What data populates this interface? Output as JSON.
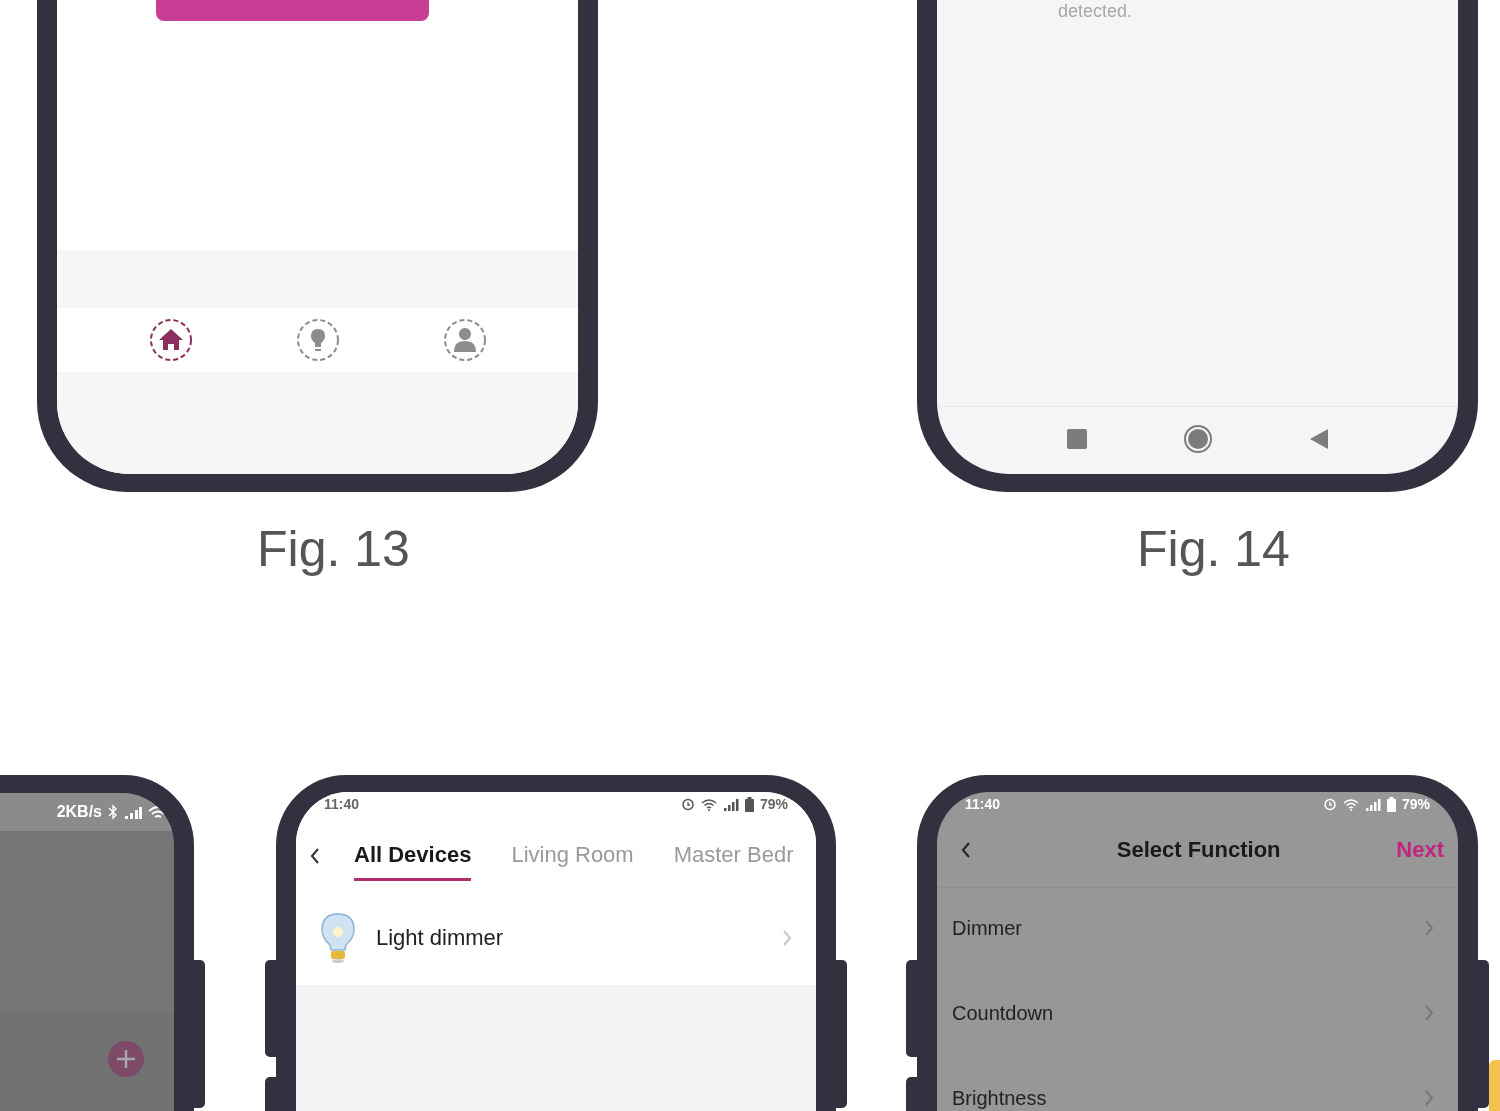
{
  "fig13": {
    "caption": "Fig. 13",
    "nav_items": [
      {
        "selected": true
      },
      {
        "selected": false
      },
      {
        "selected": false
      }
    ]
  },
  "fig14": {
    "caption": "Fig. 14",
    "description_tail": "detected."
  },
  "phone_left": {
    "status": {
      "speed": "2KB/s"
    }
  },
  "phone_devices": {
    "status": {
      "time": "11:40",
      "battery": "79%"
    },
    "tabs": [
      {
        "label": "All Devices",
        "selected": true
      },
      {
        "label": "Living Room",
        "selected": false
      },
      {
        "label": "Master Bedr",
        "selected": false
      }
    ],
    "devices": [
      {
        "name": "Light dimmer"
      }
    ]
  },
  "phone_functions": {
    "status": {
      "time": "11:40",
      "battery": "79%"
    },
    "title": "Select Function",
    "action": "Next",
    "functions": [
      {
        "label": "Dimmer"
      },
      {
        "label": "Countdown"
      },
      {
        "label": "Brightness"
      }
    ]
  }
}
